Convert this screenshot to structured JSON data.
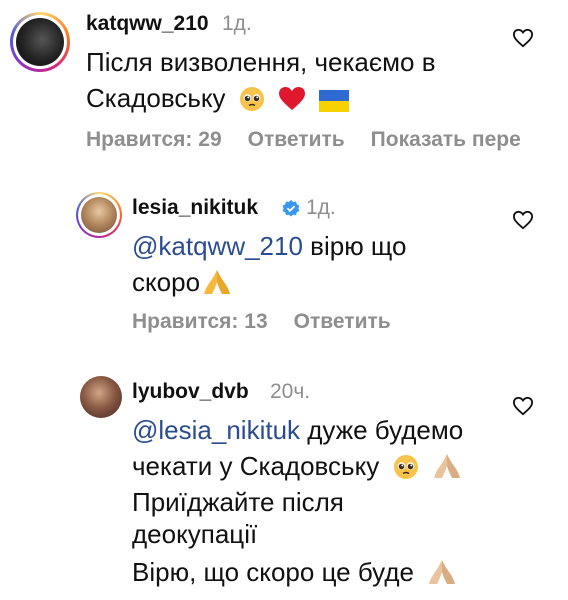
{
  "comments": [
    {
      "username": "katqww_210",
      "time": "1д.",
      "text_line1": "Після визволення, чекаємо в",
      "text_line2": "Скадовську",
      "likes": "Нравится: 29",
      "reply": "Ответить",
      "translate": "Показать пере"
    },
    {
      "username": "lesia_nikituk",
      "time": "1д.",
      "mention": "@katqww_210",
      "text_after_mention": " вірю що",
      "text_line2": "скоро",
      "likes": "Нравится: 13",
      "reply": "Ответить"
    },
    {
      "username": "lyubov_dvb",
      "time": "20ч.",
      "mention": "@lesia_nikituk",
      "text_after_mention": " дуже будемо",
      "text_line2": "чекати у Скадовську",
      "text_line3": "Приїджайте після",
      "text_line4": "деокупації",
      "text_line5": "Вірю, що скоро це буде"
    }
  ],
  "icons": [
    "heart-outline-icon",
    "verified-badge-icon",
    "pleading-face-emoji",
    "red-heart-emoji",
    "ukraine-flag-emoji",
    "folded-hands-emoji"
  ],
  "colors": {
    "mention": "#2a4d8f",
    "meta": "#8e8e8e",
    "verified": "#3897f0",
    "heart": "#e0182d"
  }
}
